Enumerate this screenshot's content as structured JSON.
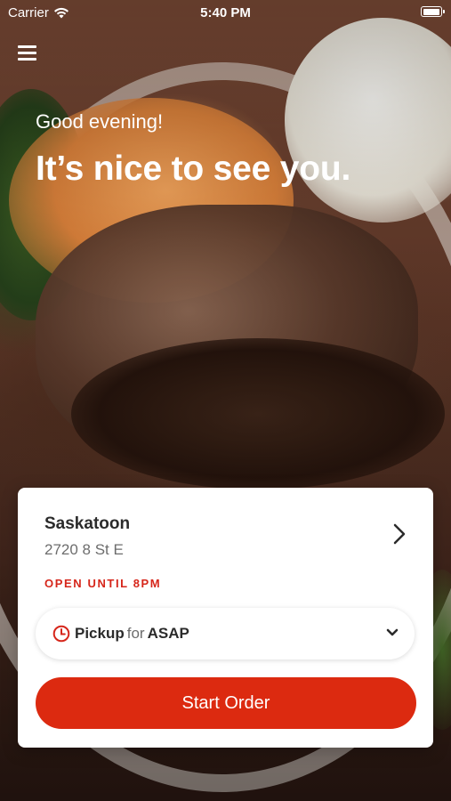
{
  "status_bar": {
    "carrier": "Carrier",
    "time": "5:40 PM",
    "wifi_icon": "wifi-icon",
    "battery_icon": "battery-icon"
  },
  "header": {
    "menu_icon": "hamburger-menu-icon"
  },
  "hero": {
    "greeting": "Good evening!",
    "headline": "It’s nice to see you."
  },
  "location_card": {
    "name": "Saskatoon",
    "address": "2720 8 St E",
    "hours_status": "OPEN UNTIL 8PM",
    "chevron_icon": "chevron-right-icon",
    "order_mode": {
      "icon": "clock-icon",
      "type": "Pickup",
      "connector": "for",
      "time": "ASAP",
      "dropdown_icon": "chevron-down-icon"
    },
    "start_order_label": "Start Order"
  },
  "colors": {
    "accent_red": "#dc2a10",
    "hours_red": "#d6261b",
    "text_dark": "#2b2b2b",
    "text_muted": "#6d6d6d"
  }
}
